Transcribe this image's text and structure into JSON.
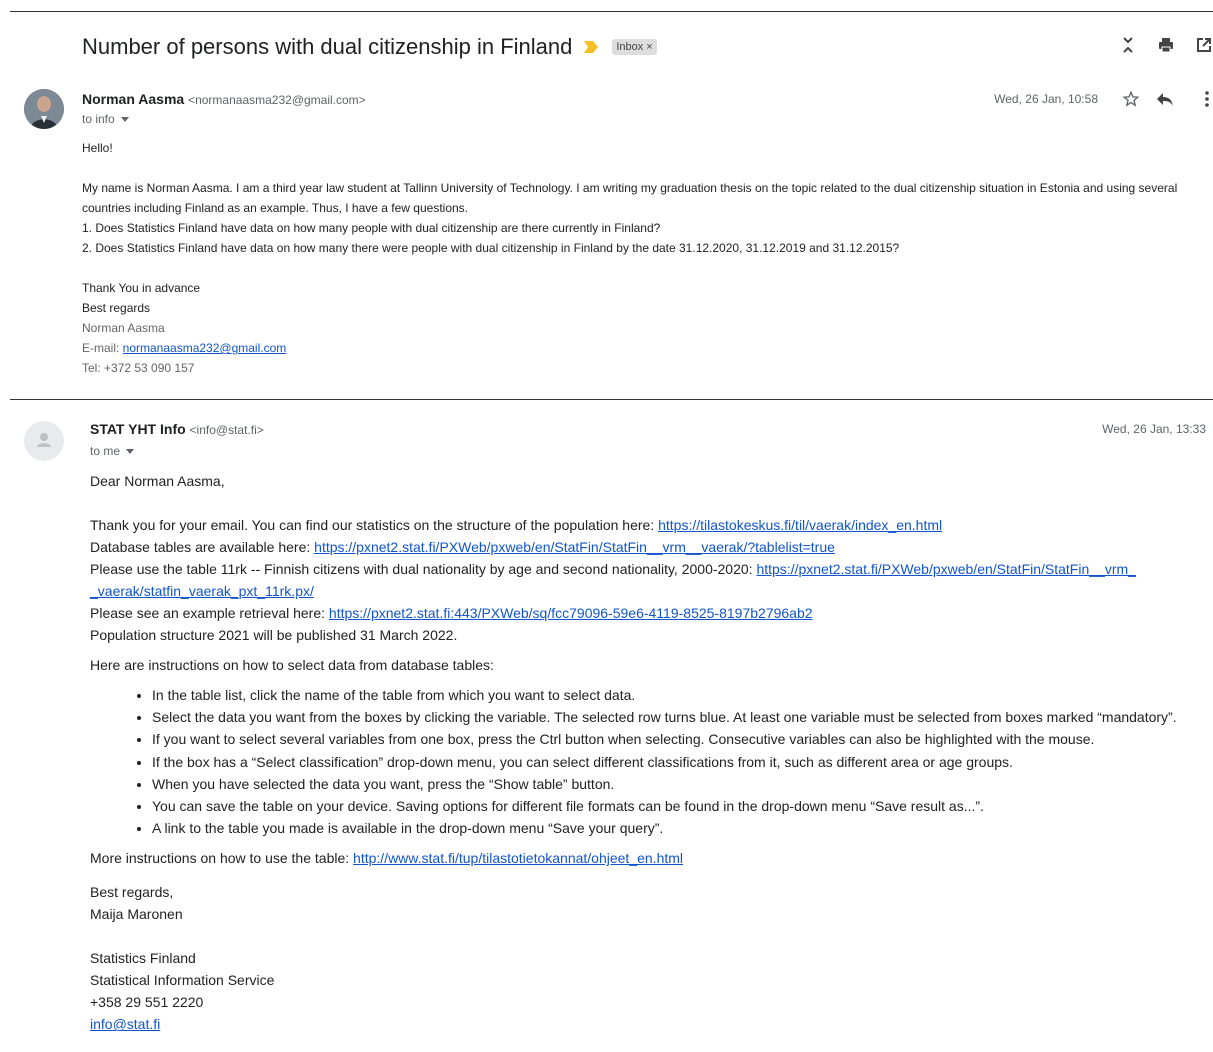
{
  "thread": {
    "subject": "Number of persons with dual citizenship in Finland",
    "label": "Inbox",
    "label_close": "×"
  },
  "top_icons": [
    "collapse-all-icon",
    "print-icon",
    "open-in-new-window-icon"
  ],
  "message1": {
    "sender_name": "Norman Aasma",
    "sender_email": "<normanaasma232@gmail.com>",
    "to": "to info",
    "date": "Wed, 26 Jan, 10:58",
    "greeting": "Hello!",
    "body_lines": [
      "My name is Norman Aasma. I am a third year law student at Tallinn University of Technology. I am writing my graduation thesis on the topic related to the dual citizenship situation in Estonia and using several countries including Finland as an example. Thus, I have a few questions.",
      "1. Does Statistics Finland have data on how many people with dual citizenship are there currently in Finland?",
      "2. Does Statistics Finland have data on how many there were people with dual citizenship in Finland by the date 31.12.2020, 31.12.2019 and 31.12.2015?"
    ],
    "closing_1": "Thank You in advance",
    "closing_2": "Best regards",
    "sig_name": "Norman Aasma",
    "sig_email_prefix": "E-mail: ",
    "sig_email": "normanaasma232@gmail.com",
    "sig_tel": "Tel: +372 53 090 157"
  },
  "message2": {
    "sender_name": "STAT YHT Info",
    "sender_email": "<info@stat.fi>",
    "to": "to me",
    "date": "Wed, 26 Jan, 13:33",
    "greeting": "Dear Norman Aasma,",
    "line1_text": "Thank you for your email. You can find our statistics on the structure of the population here: ",
    "line1_link": "https://tilastokeskus.fi/til/vaerak/index_en.html",
    "line2_text": "Database tables are available here: ",
    "line2_link": "https://pxnet2.stat.fi/PXWeb/pxweb/en/StatFin/StatFin__vrm__vaerak/?tablelist=true",
    "line3_text": "Please use the table 11rk -- Finnish citizens with dual nationality by age and second nationality, 2000-2020: ",
    "line3_link_a": "https://pxnet2.stat.fi/PXWeb/pxweb/en/StatFin/StatFin__vrm_",
    "line3_link_b": "_vaerak/statfin_vaerak_pxt_11rk.px/",
    "line4_text": "Please see an example retrieval here: ",
    "line4_link": "https://pxnet2.stat.fi:443/PXWeb/sq/fcc79096-59e6-4119-8525-8197b2796ab2",
    "line5_text": "Population structure 2021 will be published 31 March 2022.",
    "instructions_intro": "Here are instructions on how to select data from database tables:",
    "instructions": [
      "In the table list, click the name of the table from which you want to select data.",
      "Select the data you want from the boxes by clicking the variable. The selected row turns blue. At least one variable must be selected from boxes marked “mandatory”.",
      "If you want to select several variables from one box, press the Ctrl button when selecting. Consecutive variables can also be highlighted with the mouse.",
      "If the box has a “Select classification” drop-down menu, you can select different classifications from it, such as different area or age groups.",
      "When you have selected the data you want, press the “Show table” button.",
      "You can save the table on your device. Saving options for different file formats can be found in the drop-down menu “Save result as...”.",
      "A link to the table you made is available in the drop-down menu “Save your query”."
    ],
    "more_text": "More instructions on how to use the table: ",
    "more_link": "http://www.stat.fi/tup/tilastotietokannat/ohjeet_en.html",
    "regards": "Best regards,",
    "signer": "Maija Maronen",
    "org_1": "Statistics Finland",
    "org_2": "Statistical Information Service",
    "phone": "+358 29 551 2220",
    "email": "info@stat.fi"
  }
}
